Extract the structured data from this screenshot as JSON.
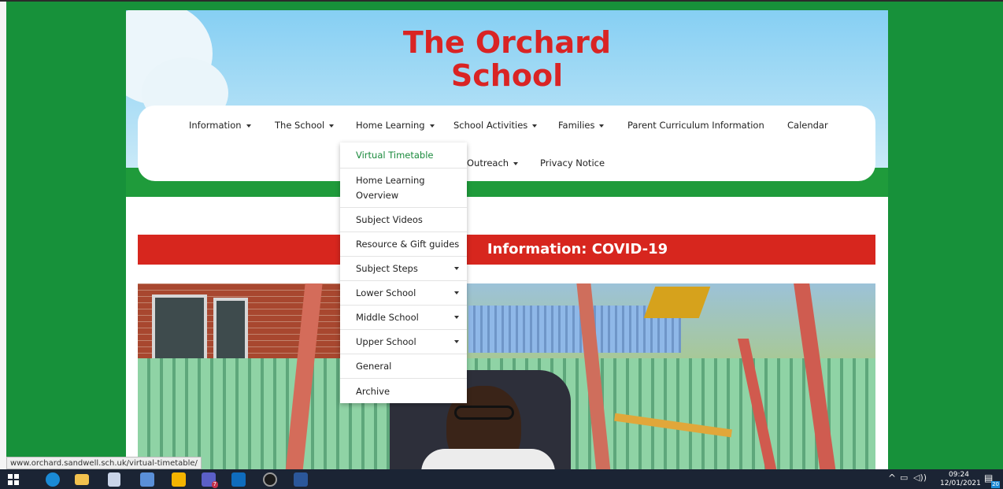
{
  "site": {
    "title_line1": "The Orchard",
    "title_line2": "School"
  },
  "nav": {
    "row1": [
      {
        "label": "Information",
        "has_caret": true
      },
      {
        "label": "The School",
        "has_caret": true
      },
      {
        "label": "Home Learning",
        "has_caret": true
      },
      {
        "label": "School Activities",
        "has_caret": true
      },
      {
        "label": "Families",
        "has_caret": true
      },
      {
        "label": "Parent Curriculum Information",
        "has_caret": false
      },
      {
        "label": "Calendar",
        "has_caret": false
      }
    ],
    "row2": [
      {
        "label": "Outreach",
        "has_caret": true
      },
      {
        "label": "Privacy Notice",
        "has_caret": false
      }
    ]
  },
  "dropdown": {
    "items": [
      {
        "label": "Virtual Timetable",
        "active": true,
        "has_caret": false
      },
      {
        "label": "Home Learning Overview",
        "active": false,
        "has_caret": false
      },
      {
        "label": "Subject Videos",
        "active": false,
        "has_caret": false
      },
      {
        "label": "Resource & Gift guides",
        "active": false,
        "has_caret": false
      },
      {
        "label": "Subject Steps",
        "active": false,
        "has_caret": true
      },
      {
        "label": "Lower School",
        "active": false,
        "has_caret": true
      },
      {
        "label": "Middle School",
        "active": false,
        "has_caret": true
      },
      {
        "label": "Upper School",
        "active": false,
        "has_caret": true
      },
      {
        "label": "General",
        "active": false,
        "has_caret": false
      },
      {
        "label": "Archive",
        "active": false,
        "has_caret": false
      }
    ]
  },
  "banner": {
    "text": "Information: COVID-19"
  },
  "status_bar": {
    "url": "www.orchard.sandwell.sch.uk/virtual-timetable/"
  },
  "taskbar": {
    "time": "09:24",
    "date": "12/01/2021",
    "notification_count": "20",
    "teams_badge": "7"
  },
  "colors": {
    "background_green": "#17913a",
    "title_red": "#d92424",
    "banner_red": "#d7261e",
    "active_link_green": "#1a8a3c"
  }
}
